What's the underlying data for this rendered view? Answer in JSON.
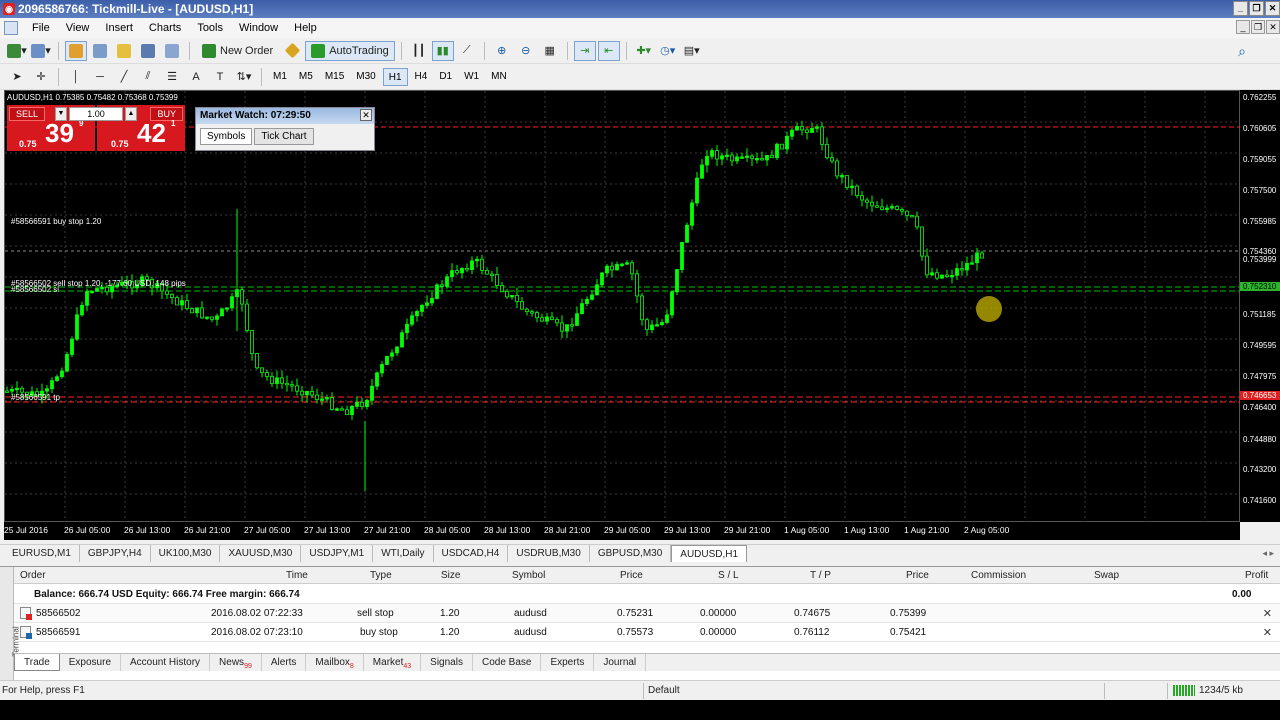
{
  "window": {
    "title": "2096586766: Tickmill-Live - [AUDUSD,H1]"
  },
  "menu": [
    "File",
    "View",
    "Insert",
    "Charts",
    "Tools",
    "Window",
    "Help"
  ],
  "toolbar": {
    "new_order": "New Order",
    "autotrading": "AutoTrading"
  },
  "timeframes": [
    "M1",
    "M5",
    "M15",
    "M30",
    "H1",
    "H4",
    "D1",
    "W1",
    "MN"
  ],
  "active_timeframe": "H1",
  "chart": {
    "header": "AUDUSD,H1  0.75385 0.75482 0.75368 0.75399",
    "one_click": {
      "sell_label": "SELL",
      "buy_label": "BUY",
      "volume": "1.00",
      "sell_prefix": "0.75",
      "sell_big": "39",
      "sell_sup": "9",
      "buy_prefix": "0.75",
      "buy_big": "42",
      "buy_sup": "1"
    },
    "market_watch": {
      "title": "Market Watch: 07:29:50",
      "tabs": [
        "Symbols",
        "Tick Chart"
      ]
    },
    "order_labels": [
      "#58566591 buy stop 1.20",
      "#58566502 sell stop 1.20, -177.60 USD, 148 pips",
      "#58566502 sl",
      "#58566591 tp"
    ],
    "price_axis": [
      "0.762255",
      "0.760605",
      "0.759055",
      "0.757500",
      "0.755985",
      "0.754360",
      "0.753999",
      "0.752310",
      "0.751185",
      "0.749595",
      "0.747975",
      "0.746653",
      "0.746400",
      "0.744880",
      "0.743200",
      "0.741600"
    ],
    "time_axis": [
      "25 Jul 2016",
      "26 Jul 05:00",
      "26 Jul 13:00",
      "26 Jul 21:00",
      "27 Jul 05:00",
      "27 Jul 13:00",
      "27 Jul 21:00",
      "28 Jul 05:00",
      "28 Jul 13:00",
      "28 Jul 21:00",
      "29 Jul 05:00",
      "29 Jul 13:00",
      "29 Jul 21:00",
      "1 Aug 05:00",
      "1 Aug 13:00",
      "1 Aug 21:00",
      "2 Aug 05:00"
    ],
    "colors": {
      "background": "#000000",
      "candle": "#00ff00",
      "grid": "#555555",
      "stop_line": "#ff2020",
      "order_line": "#00c000"
    }
  },
  "chart_tabs": [
    "EURUSD,M1",
    "GBPJPY,H4",
    "UK100,M30",
    "XAUUSD,M30",
    "USDJPY,M1",
    "WTI,Daily",
    "USDCAD,H4",
    "USDRUB,M30",
    "GBPUSD,M30",
    "AUDUSD,H1"
  ],
  "active_chart_tab": "AUDUSD,H1",
  "terminal": {
    "side_label": "Terminal",
    "columns": [
      "Order",
      "Time",
      "Type",
      "Size",
      "Symbol",
      "Price",
      "S / L",
      "T / P",
      "Price",
      "Commission",
      "Swap",
      "Profit"
    ],
    "balance_line": "Balance: 666.74 USD  Equity: 666.74  Free margin: 666.74",
    "balance_profit": "0.00",
    "rows": [
      {
        "order": "58566502",
        "time": "2016.08.02 07:22:33",
        "type": "sell stop",
        "size": "1.20",
        "symbol": "audusd",
        "price": "0.75231",
        "sl": "0.00000",
        "tp": "0.74675",
        "cur_price": "0.75399",
        "kind": "sell"
      },
      {
        "order": "58566591",
        "time": "2016.08.02 07:23:10",
        "type": "buy stop",
        "size": "1.20",
        "symbol": "audusd",
        "price": "0.75573",
        "sl": "0.00000",
        "tp": "0.76112",
        "cur_price": "0.75421",
        "kind": "buy"
      }
    ],
    "tabs": [
      {
        "label": "Trade",
        "badge": ""
      },
      {
        "label": "Exposure",
        "badge": ""
      },
      {
        "label": "Account History",
        "badge": ""
      },
      {
        "label": "News",
        "badge": "99"
      },
      {
        "label": "Alerts",
        "badge": ""
      },
      {
        "label": "Mailbox",
        "badge": "8"
      },
      {
        "label": "Market",
        "badge": "43"
      },
      {
        "label": "Signals",
        "badge": ""
      },
      {
        "label": "Code Base",
        "badge": ""
      },
      {
        "label": "Experts",
        "badge": ""
      },
      {
        "label": "Journal",
        "badge": ""
      }
    ],
    "active_tab": "Trade"
  },
  "status": {
    "help": "For Help, press F1",
    "profile": "Default",
    "traffic": "1234/5 kb"
  }
}
